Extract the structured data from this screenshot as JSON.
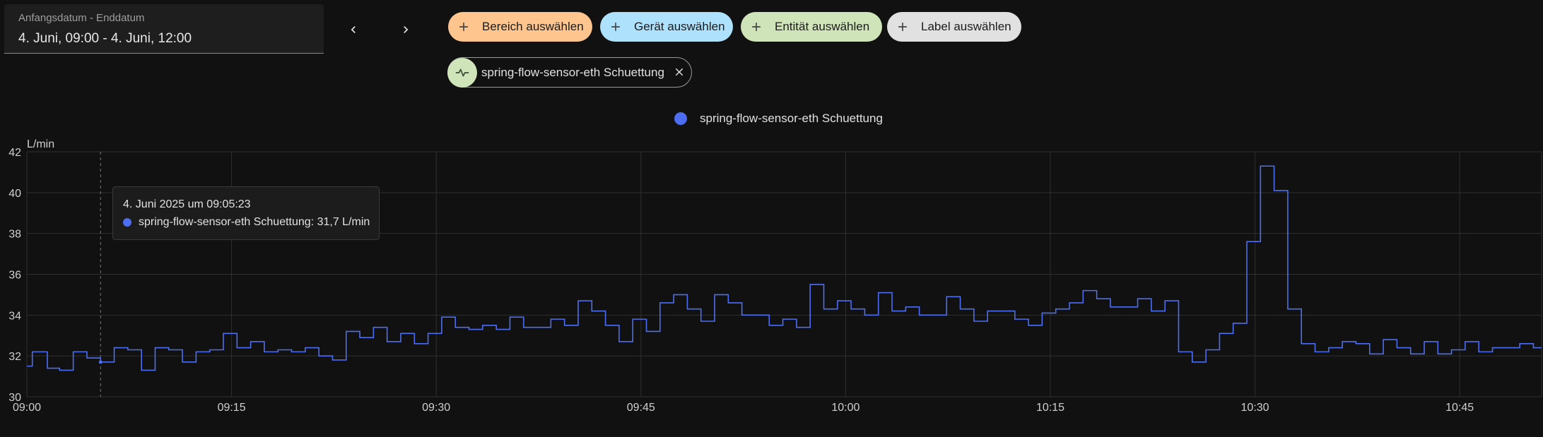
{
  "date_picker": {
    "label": "Anfangsdatum - Enddatum",
    "value": "4. Juni, 09:00 - 4. Juni, 12:00"
  },
  "nav": {
    "prev_icon": "chevron-left-icon",
    "next_icon": "chevron-right-icon"
  },
  "target_chips": [
    {
      "label": "Bereich auswählen",
      "color": "#fec58f"
    },
    {
      "label": "Gerät auswählen",
      "color": "#aee1fb"
    },
    {
      "label": "Entität auswählen",
      "color": "#cfe5b9"
    },
    {
      "label": "Label auswählen",
      "color": "#e1e1e1"
    }
  ],
  "entity_chip": {
    "name": "spring-flow-sensor-eth Schuettung",
    "icon": "pulse-icon",
    "avatar_color": "#cfe5b9"
  },
  "legend": {
    "label": "spring-flow-sensor-eth Schuettung",
    "color": "#4d6ef0"
  },
  "tooltip": {
    "title": "4. Juni 2025 um 09:05:23",
    "line": "spring-flow-sensor-eth Schuettung: 31,7 L/min"
  },
  "chart_data": {
    "type": "line",
    "step": true,
    "ylabel": "L/min",
    "ylim": [
      30,
      42
    ],
    "yticks": [
      30,
      32,
      34,
      36,
      38,
      40,
      42
    ],
    "xlim_minutes": [
      0,
      111
    ],
    "xticks": [
      {
        "m": 0,
        "label": "09:00"
      },
      {
        "m": 15,
        "label": "09:15"
      },
      {
        "m": 30,
        "label": "09:30"
      },
      {
        "m": 45,
        "label": "09:45"
      },
      {
        "m": 60,
        "label": "10:00"
      },
      {
        "m": 75,
        "label": "10:15"
      },
      {
        "m": 90,
        "label": "10:30"
      },
      {
        "m": 105,
        "label": "10:45"
      }
    ],
    "grid": true,
    "hover_x_minutes": 5.4,
    "hover_value": 31.7,
    "series": [
      {
        "name": "spring-flow-sensor-eth Schuettung",
        "color": "#4d6ef0",
        "x": [
          0,
          0.4,
          1.5,
          2.4,
          3.4,
          4.4,
          5.4,
          6.4,
          7.4,
          8.4,
          9.4,
          10.4,
          11.4,
          12.4,
          13.4,
          14.4,
          15.4,
          16.4,
          17.4,
          18.4,
          19.4,
          20.4,
          21.4,
          22.4,
          23.4,
          24.4,
          25.4,
          26.4,
          27.4,
          28.4,
          29.4,
          30.4,
          31.4,
          32.4,
          33.4,
          34.4,
          35.4,
          36.4,
          37.4,
          38.4,
          39.4,
          40.4,
          41.4,
          42.4,
          43.4,
          44.4,
          45.4,
          46.4,
          47.4,
          48.4,
          49.4,
          50.4,
          51.4,
          52.4,
          53.4,
          54.4,
          55.4,
          56.4,
          57.4,
          58.4,
          59.4,
          60.4,
          61.4,
          62.4,
          63.4,
          64.4,
          65.4,
          66.4,
          67.4,
          68.4,
          69.4,
          70.4,
          71.4,
          72.4,
          73.4,
          74.4,
          75.4,
          76.4,
          77.4,
          78.4,
          79.4,
          80.4,
          81.4,
          82.4,
          83.4,
          84.4,
          85.4,
          86.4,
          87.4,
          88.4,
          89.4,
          90.4,
          91.4,
          92.4,
          93.4,
          94.4,
          95.4,
          96.4,
          97.4,
          98.4,
          99.4,
          100.4,
          101.4,
          102.4,
          103.4,
          104.4,
          105.4,
          106.4,
          107.4,
          108.4,
          109.4,
          110.4,
          111
        ],
        "values": [
          31.5,
          32.2,
          31.4,
          31.3,
          32.2,
          31.9,
          31.7,
          32.4,
          32.3,
          31.3,
          32.4,
          32.3,
          31.7,
          32.2,
          32.3,
          33.1,
          32.4,
          32.7,
          32.2,
          32.3,
          32.2,
          32.4,
          32.0,
          31.8,
          33.2,
          32.9,
          33.4,
          32.7,
          33.1,
          32.6,
          33.1,
          33.9,
          33.4,
          33.3,
          33.5,
          33.3,
          33.9,
          33.4,
          33.4,
          33.8,
          33.5,
          34.7,
          34.2,
          33.5,
          32.7,
          33.8,
          33.2,
          34.6,
          35.0,
          34.3,
          33.7,
          35.0,
          34.6,
          34.0,
          34.0,
          33.5,
          33.8,
          33.4,
          35.5,
          34.3,
          34.7,
          34.3,
          34.0,
          35.1,
          34.2,
          34.4,
          34.0,
          34.0,
          34.9,
          34.3,
          33.7,
          34.2,
          34.2,
          33.8,
          33.5,
          34.1,
          34.3,
          34.6,
          35.2,
          34.8,
          34.4,
          34.4,
          34.8,
          34.2,
          34.7,
          32.2,
          31.7,
          32.3,
          33.1,
          33.6,
          37.6,
          41.3,
          40.1,
          34.3,
          32.6,
          32.2,
          32.4,
          32.7,
          32.6,
          32.1,
          32.8,
          32.4,
          32.1,
          32.7,
          32.1,
          32.3,
          32.7,
          32.2,
          32.4,
          32.4,
          32.6,
          32.4,
          32.4
        ]
      }
    ]
  }
}
